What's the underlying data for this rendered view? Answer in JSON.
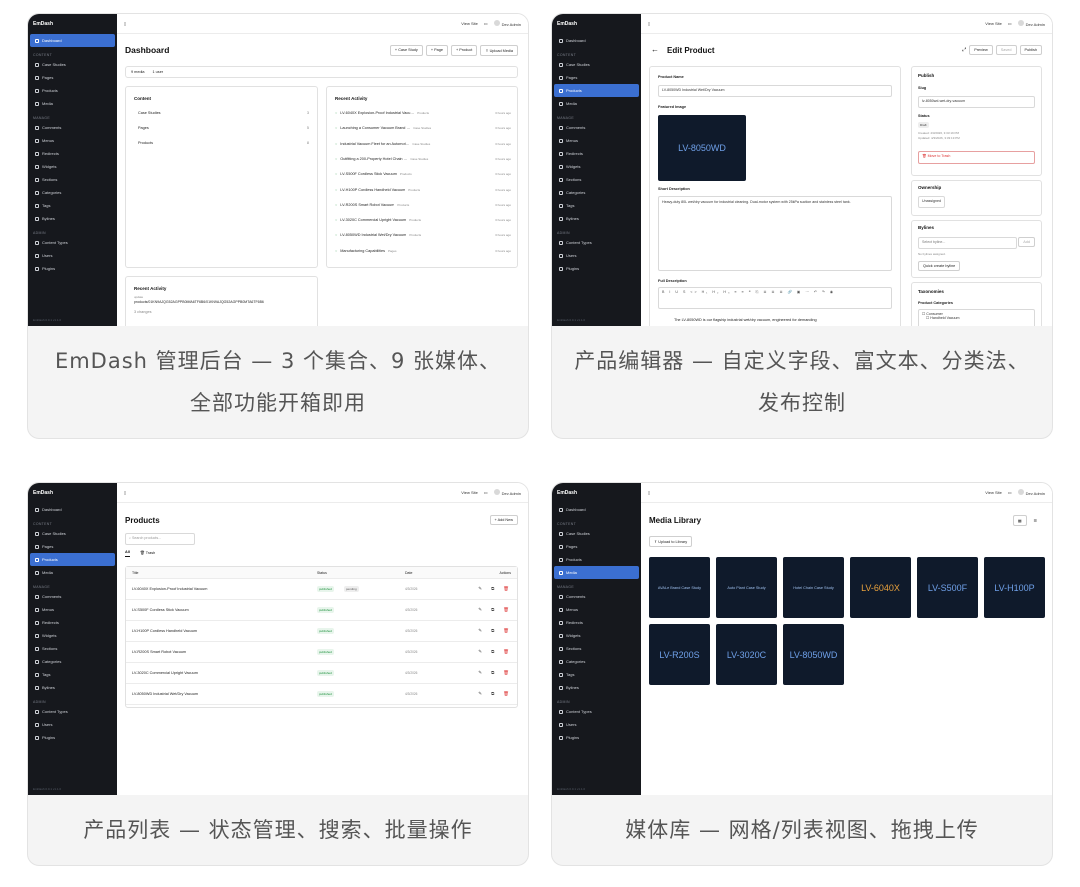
{
  "sidebar": {
    "brand": "EmDash",
    "sections": {
      "content": "CONTENT",
      "manage": "MANAGE",
      "admin": "ADMIN"
    },
    "dashboard": "Dashboard",
    "content_items": [
      "Case Studies",
      "Pages",
      "Products",
      "Media"
    ],
    "manage_items": [
      "Comments",
      "Menus",
      "Redirects",
      "Widgets",
      "Sections",
      "Categories",
      "Tags",
      "Bylines"
    ],
    "admin_items": [
      "Content Types",
      "Users",
      "Plugins"
    ],
    "version": "EmDash 0.0.1 v1.1.0"
  },
  "topbar": {
    "view_site": "View Site",
    "user": "Dev Admin"
  },
  "card1": {
    "title": "Dashboard",
    "buttons": [
      "+ Case Study",
      "+ Page",
      "+ Product",
      "⇪ Upload Media"
    ],
    "meta": [
      "9 media",
      "1 user"
    ],
    "content_title": "Content",
    "content_rows": [
      {
        "name": "Case Studies",
        "count": "3"
      },
      {
        "name": "Pages",
        "count": "5"
      },
      {
        "name": "Products",
        "count": "8"
      }
    ],
    "recent_title": "Recent Activity",
    "recent_rows": [
      {
        "title": "LV-6040X Explosion-Proof Industrial Vacu…",
        "type": "Products",
        "time": "3 hours ago"
      },
      {
        "title": "Launching a Consumer Vacuum Brand …",
        "type": "Case Studies",
        "time": "3 hours ago"
      },
      {
        "title": "Industrial Vacuum Fleet for an Automot…",
        "type": "Case Studies",
        "time": "3 hours ago"
      },
      {
        "title": "Outfitting a 200-Property Hotel Chain …",
        "type": "Case Studies",
        "time": "3 hours ago"
      },
      {
        "title": "LV-S500F Cordless Stick Vacuum",
        "type": "Products",
        "time": "3 hours ago"
      },
      {
        "title": "LV-H100P Cordless Handheld Vacuum",
        "type": "Products",
        "time": "3 hours ago"
      },
      {
        "title": "LV-R200S Smart Robot Vacuum",
        "type": "Products",
        "time": "3 hours ago"
      },
      {
        "title": "LV-3020C Commercial Upright Vacuum",
        "type": "Products",
        "time": "3 hours ago"
      },
      {
        "title": "LV-8050WD Industrial Wet/Dry Vacuum",
        "type": "Products",
        "time": "3 hours ago"
      },
      {
        "title": "Manufacturing Capabilities",
        "type": "Pages",
        "time": "3 hours ago"
      }
    ],
    "activity2_title": "Recent Activity",
    "activity2_l1": "update",
    "activity2_l2": "products/01KN9AJQG52AGPPB0MfA6TF6B6/01KN9AJQG52AGPPB0MTA6TF6B6",
    "activity2_l3": "3 changes",
    "caption": "EmDash 管理后台 — 3 个集合、9 张媒体、全部功能开箱即用"
  },
  "card2": {
    "title": "Edit Product",
    "btn_preview": "Preview",
    "btn_saved": "Saved",
    "btn_publish": "Publish",
    "product_name_label": "Product Name",
    "product_name": "LV-8050WD Industrial Wet/Dry Vacuum",
    "featured_label": "Featured Image",
    "featured_text": "LV-8050WD",
    "short_label": "Short Description",
    "short_text": "Heavy-duty 80L wet/dry vacuum for industrial cleaning. Dual-motor system with 25kPa suction and stainless steel tank.",
    "full_label": "Full Description",
    "full_text": "The LV-8050WD is our flagship industrial wet/dry vacuum, engineered for demanding",
    "publish_title": "Publish",
    "slug_label": "Slug",
    "slug": "lv-8050wd-wet-dry-vacuum",
    "status_label": "Status",
    "status": "Draft",
    "created": "Created: 4/3/2026, 3:33:19 PM",
    "updated": "Updated: 4/3/2026, 3:33:19 PM",
    "trash": "Move to Trash",
    "ownership_title": "Ownership",
    "ownership_value": "Unassigned",
    "bylines_title": "Bylines",
    "byline_placeholder": "Select byline...",
    "byline_add": "Add",
    "no_bylines": "No bylines assigned.",
    "quick_byline": "Quick create byline",
    "tax_title": "Taxonomies",
    "tax_sub": "Product Categories",
    "tax_items": [
      "Consumer",
      "Handheld Vacuum"
    ],
    "caption": "产品编辑器 — 自定义字段、富文本、分类法、发布控制"
  },
  "card3": {
    "title": "Products",
    "add_new": "+ Add New",
    "search_placeholder": "Search products...",
    "tab_all": "All",
    "tab_trash": "Trash",
    "headers": [
      "Title",
      "Status",
      "Date",
      "Actions"
    ],
    "rows": [
      {
        "title": "LV-6040X Explosion-Proof Industrial Vacuum",
        "status": "published",
        "extra": "pending",
        "date": "4/3/2026"
      },
      {
        "title": "LV-S500F Cordless Stick Vacuum",
        "status": "published",
        "extra": "",
        "date": "4/3/2026"
      },
      {
        "title": "LV-H100P Cordless Handheld Vacuum",
        "status": "published",
        "extra": "",
        "date": "4/3/2026"
      },
      {
        "title": "LV-R200S Smart Robot Vacuum",
        "status": "published",
        "extra": "",
        "date": "4/3/2026"
      },
      {
        "title": "LV-3020C Commercial Upright Vacuum",
        "status": "published",
        "extra": "",
        "date": "4/3/2026"
      },
      {
        "title": "LV-8050WD Industrial Wet/Dry Vacuum",
        "status": "published",
        "extra": "",
        "date": "4/3/2026"
      }
    ],
    "caption": "产品列表 — 状态管理、搜索、批量操作"
  },
  "card4": {
    "title": "Media Library",
    "upload": "Upload to Library",
    "tiles": [
      {
        "label": "AVALe Brand Case Study",
        "kind": "sm"
      },
      {
        "label": "Auto Plant Case Study",
        "kind": "sm"
      },
      {
        "label": "Hotel Chain Case Study",
        "kind": "sm"
      },
      {
        "label": "LV-6040X",
        "kind": "or"
      },
      {
        "label": "LV-S500F",
        "kind": "big"
      },
      {
        "label": "LV-H100P",
        "kind": "big"
      },
      {
        "label": "LV-R200S",
        "kind": "big"
      },
      {
        "label": "LV-3020C",
        "kind": "big"
      },
      {
        "label": "LV-8050WD",
        "kind": "big"
      }
    ],
    "caption": "媒体库 — 网格/列表视图、拖拽上传"
  },
  "colors": {
    "accent": "#3b6fd1",
    "sidebar": "#16181d",
    "published": "#1a8f3a",
    "danger": "#d33"
  }
}
